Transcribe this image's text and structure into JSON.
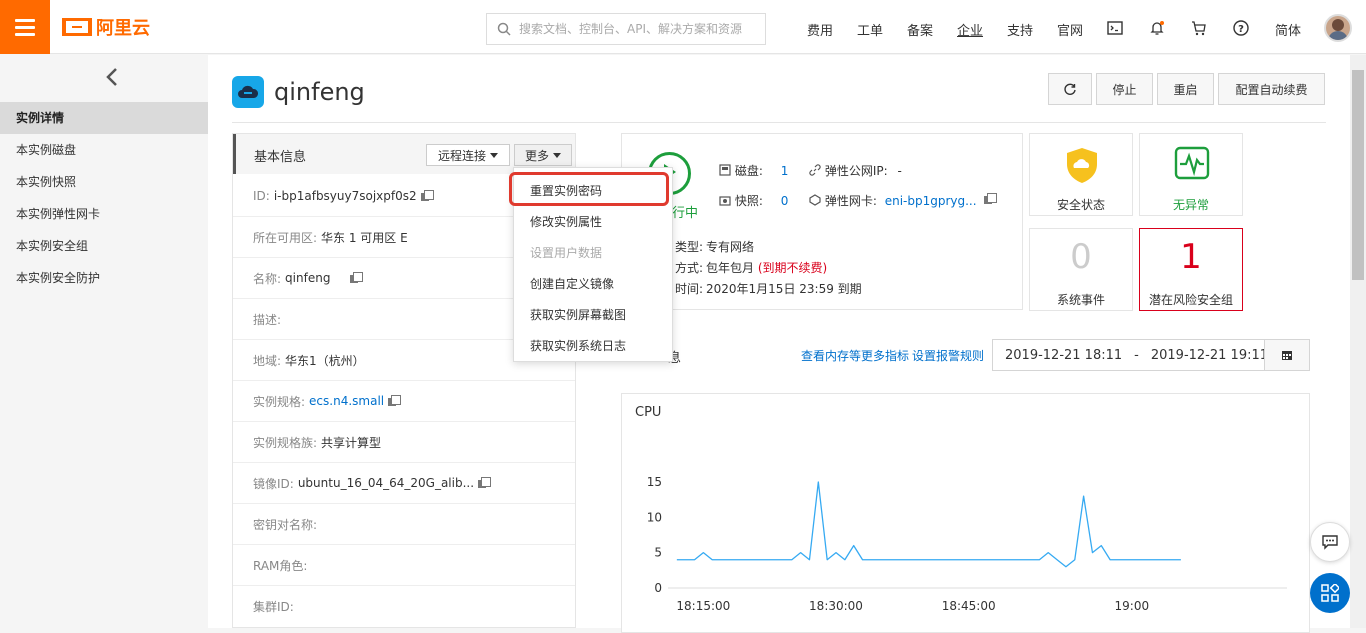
{
  "header": {
    "logo_text": "阿里云",
    "search_placeholder": "搜索文档、控制台、API、解决方案和资源",
    "nav": [
      "费用",
      "工单",
      "备案",
      "企业",
      "支持",
      "官网"
    ],
    "lang": "简体",
    "icons": [
      "menu-icon",
      "search-icon",
      "terminal-icon",
      "bell-icon",
      "cart-icon",
      "help-icon"
    ],
    "accent_color": "#ff6a00"
  },
  "sidebar": {
    "items": [
      {
        "label": "实例详情",
        "active": true
      },
      {
        "label": "本实例磁盘"
      },
      {
        "label": "本实例快照"
      },
      {
        "label": "本实例弹性网卡"
      },
      {
        "label": "本实例安全组"
      },
      {
        "label": "本实例安全防护"
      }
    ]
  },
  "instance": {
    "name": "qinfeng",
    "actions": [
      "停止",
      "重启",
      "配置自动续费"
    ]
  },
  "basic_info": {
    "title": "基本信息",
    "remote_btn": "远程连接",
    "more_btn": "更多",
    "rows": [
      {
        "label": "ID:",
        "value": "i-bp1afbsyuy7sojxpf0s2",
        "copy": true
      },
      {
        "label": "所在可用区:",
        "value": "华东 1 可用区 E"
      },
      {
        "label": "名称:",
        "value": "qinfeng",
        "copy": true
      },
      {
        "label": "描述:",
        "value": ""
      },
      {
        "label": "地域:",
        "value": "华东1（杭州）"
      },
      {
        "label": "实例规格:",
        "value": "ecs.n4.small",
        "link": true,
        "copy": true
      },
      {
        "label": "实例规格族:",
        "value": "共享计算型"
      },
      {
        "label": "镜像ID:",
        "value": "ubuntu_16_04_64_20G_alib...",
        "copy": true
      },
      {
        "label": "密钥对名称:",
        "value": ""
      },
      {
        "label": "RAM角色:",
        "value": ""
      },
      {
        "label": "集群ID:",
        "value": ""
      }
    ]
  },
  "more_menu": {
    "items": [
      {
        "label": "重置实例密码",
        "highlighted": true
      },
      {
        "label": "修改实例属性"
      },
      {
        "label": "设置用户数据",
        "disabled": true
      },
      {
        "label": "创建自定义镜像"
      },
      {
        "label": "获取实例屏幕截图"
      },
      {
        "label": "获取实例系统日志"
      }
    ]
  },
  "status": {
    "running_text": "行中",
    "disk_label": "磁盘:",
    "disk_value": "1",
    "snapshot_label": "快照:",
    "snapshot_value": "0",
    "eip_label": "弹性公网IP:",
    "eip_value": "-",
    "eni_label": "弹性网卡:",
    "eni_value": "eni-bp1gpryg...",
    "net_type_label": "类型:",
    "net_type_value": "专有网络",
    "pay_label": "方式:",
    "pay_value": "包年包月",
    "pay_note": "(到期不续费)",
    "expire_label": "时间:",
    "expire_value": "2020年1月15日 23:59 到期"
  },
  "tiles": {
    "security_label": "安全状态",
    "ok_label": "无异常",
    "events_num": "0",
    "events_label": "系统事件",
    "risk_num": "1",
    "risk_label": "潜在风险安全组"
  },
  "monitor": {
    "section_title": "息",
    "more_metrics": "查看内存等更多指标",
    "alert_rules": "设置报警规则",
    "date_from": "2019-12-21 18:11",
    "date_sep": "-",
    "date_to": "2019-12-21 19:11"
  },
  "chart_data": {
    "type": "line",
    "title": "CPU",
    "ylim": [
      0,
      15
    ],
    "yticks": [
      "0",
      "5",
      "10",
      "15"
    ],
    "xticks": [
      "18:15:00",
      "18:30:00",
      "18:45:00",
      "19:00"
    ],
    "series": [
      {
        "color": "#36aaf2",
        "x": [
          11,
          13,
          14,
          15,
          16,
          18,
          20,
          22,
          24,
          25,
          26,
          27,
          28,
          29,
          30,
          31,
          32,
          33,
          34,
          35,
          36,
          38,
          40,
          42,
          44,
          46,
          48,
          50,
          52,
          53,
          54,
          55,
          56,
          57,
          58,
          59,
          60,
          62,
          64,
          66,
          68
        ],
        "y": [
          4,
          4,
          5,
          4,
          4,
          4,
          4,
          4,
          4,
          5,
          4,
          15,
          4,
          5,
          4,
          6,
          4,
          4,
          4,
          4,
          4,
          4,
          4,
          4,
          4,
          4,
          4,
          4,
          4,
          5,
          4,
          3,
          4,
          13,
          5,
          6,
          4,
          4,
          4,
          4,
          4
        ]
      }
    ]
  }
}
